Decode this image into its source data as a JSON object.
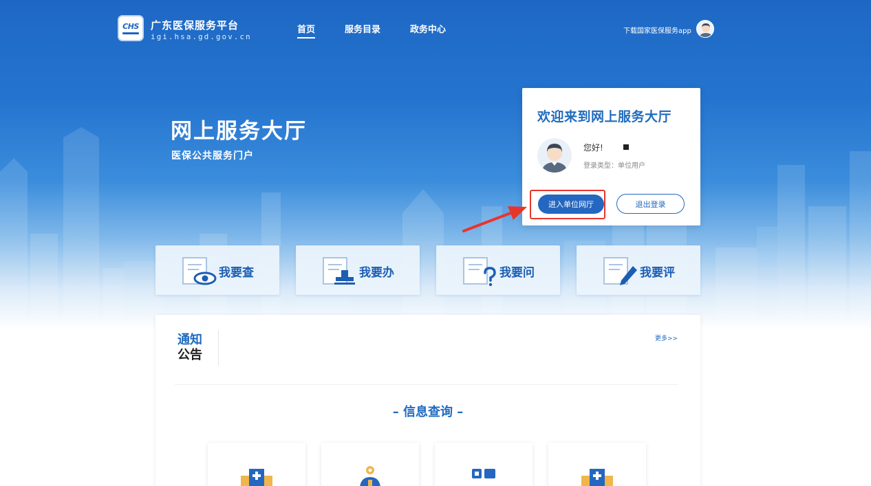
{
  "header": {
    "logo_text": "CHS",
    "site_title": "广东医保服务平台",
    "site_url": "igi.hsa.gd.gov.cn",
    "nav": [
      {
        "label": "首页",
        "active": true
      },
      {
        "label": "服务目录",
        "active": false
      },
      {
        "label": "政务中心",
        "active": false
      }
    ],
    "download_label": "下载国家医保服务app"
  },
  "hero": {
    "title": "网上服务大厅",
    "subtitle": "医保公共服务门户"
  },
  "welcome": {
    "title": "欢迎来到网上服务大厅",
    "greeting": "您好!",
    "login_type": "登录类型：单位用户",
    "enter_button": "进入单位网厅",
    "logout_button": "退出登录"
  },
  "services": [
    {
      "label": "我要查",
      "icon": "eye-document-icon"
    },
    {
      "label": "我要办",
      "icon": "stamp-document-icon"
    },
    {
      "label": "我要问",
      "icon": "question-document-icon"
    },
    {
      "label": "我要评",
      "icon": "pen-document-icon"
    }
  ],
  "notice": {
    "title_line1": "通知",
    "title_line2": "公告",
    "more": "更多>>"
  },
  "info_query": {
    "title": "– 信息查询 –",
    "cards": [
      {
        "icon": "medical-kit-icon"
      },
      {
        "icon": "person-location-icon"
      },
      {
        "icon": "id-card-icon"
      },
      {
        "icon": "medical-kit-icon"
      }
    ]
  },
  "colors": {
    "primary": "#1f6bbf",
    "header_bg": "#1e68c4",
    "highlight_red": "#e8352c"
  }
}
